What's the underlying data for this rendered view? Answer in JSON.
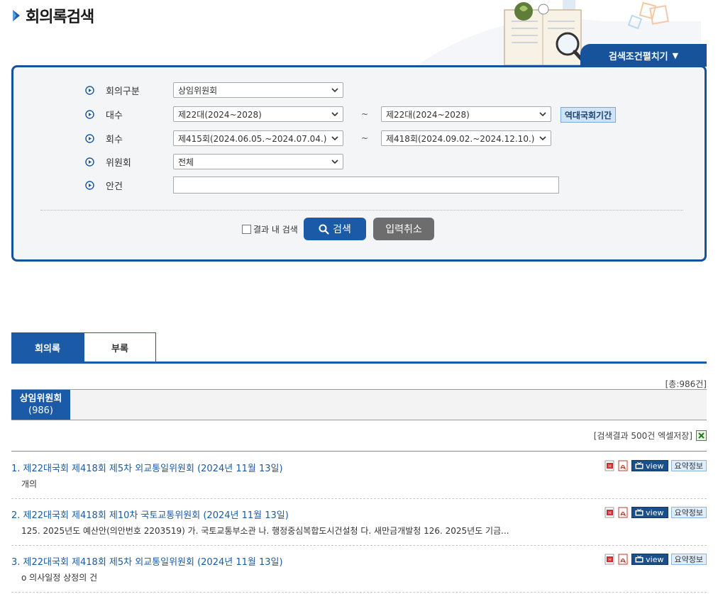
{
  "header": {
    "title": "회의록검색",
    "toggle_label": "검색조건펼치기"
  },
  "search": {
    "rows": [
      {
        "label": "회의구분",
        "from": "상임위원회"
      },
      {
        "label": "대수",
        "from": "제22대(2024~2028)",
        "to": "제22대(2024~2028)"
      },
      {
        "label": "회수",
        "from": "제415회(2024.06.05.~2024.07.04.)",
        "to": "제418회(2024.09.02.~2024.12.10.)"
      },
      {
        "label": "위원회",
        "from": "전체"
      },
      {
        "label": "안건",
        "value": ""
      }
    ],
    "range_separator": "~",
    "era_button": "역대국회기간",
    "within_results_label": "결과 내 검색",
    "within_results_checked": false,
    "search_button": "검색",
    "reset_button": "입력취소"
  },
  "tabs": [
    {
      "label": "회의록",
      "active": true
    },
    {
      "label": "부록",
      "active": false
    }
  ],
  "total_count": "[총:986건]",
  "committee_tab": {
    "name": "상임위원회",
    "count": "(986)"
  },
  "excel_label": "[검색결과 500건 엑셀저장]",
  "actions": {
    "view": "view",
    "summary_info": "요약정보"
  },
  "results": [
    {
      "title": "1. 제22대국회 제418회 제5차 외교통일위원회 (2024년 11월 13일)",
      "summary": "개의"
    },
    {
      "title": "2. 제22대국회 제418회 제10차 국토교통위원회 (2024년 11월 13일)",
      "summary": "125. 2025년도 예산안(의안번호 2203519) 가. 국토교통부소관 나. 행정중심복합도시건설청 다. 새만금개발청 126. 2025년도 기금..."
    },
    {
      "title": "3. 제22대국회 제418회 제5차 외교통일위원회 (2024년 11월 13일)",
      "summary": "o 의사일정 상정의 건"
    }
  ],
  "colors": {
    "primary": "#1a5aa6",
    "panel_border": "#16539a",
    "link": "#1b5ba0",
    "reset": "#6d6d6d"
  }
}
